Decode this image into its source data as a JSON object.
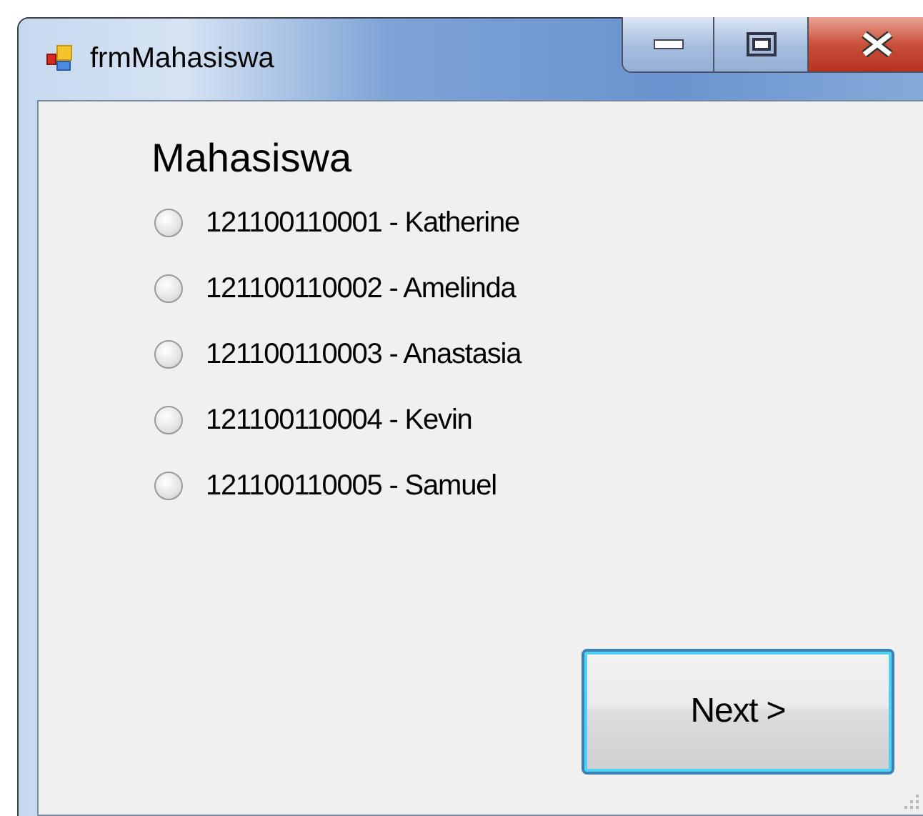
{
  "window": {
    "title": "frmMahasiswa"
  },
  "heading": "Mahasiswa",
  "options": [
    {
      "label": "121100110001 - Katherine",
      "selected": false
    },
    {
      "label": "121100110002 - Amelinda",
      "selected": false
    },
    {
      "label": "121100110003 - Anastasia",
      "selected": false
    },
    {
      "label": "121100110004 - Kevin",
      "selected": false
    },
    {
      "label": "121100110005 - Samuel",
      "selected": false
    }
  ],
  "buttons": [
    {
      "label": "Next >",
      "focused": true
    }
  ]
}
